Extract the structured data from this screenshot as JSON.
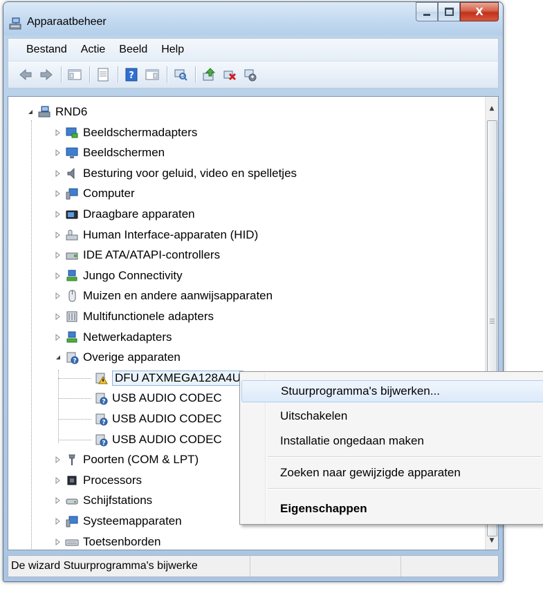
{
  "window": {
    "title": "Apparaatbeheer",
    "close_glyph": "X"
  },
  "menubar": {
    "items": [
      "Bestand",
      "Actie",
      "Beeld",
      "Help"
    ]
  },
  "toolbar": {
    "buttons": [
      "back-icon",
      "forward-icon",
      "show-hide-console-tree-icon",
      "properties-icon",
      "help-icon",
      "show-action-pane-icon",
      "scan-hardware-icon",
      "update-driver-icon",
      "uninstall-icon",
      "disable-icon"
    ]
  },
  "tree": {
    "root": "RND6",
    "items": [
      {
        "label": "Beeldschermadapters",
        "icon": "display-adapter-icon"
      },
      {
        "label": "Beeldschermen",
        "icon": "monitor-icon"
      },
      {
        "label": "Besturing voor geluid, video en spelletjes",
        "icon": "speaker-icon"
      },
      {
        "label": "Computer",
        "icon": "computer-icon"
      },
      {
        "label": "Draagbare apparaten",
        "icon": "portable-device-icon"
      },
      {
        "label": "Human Interface-apparaten (HID)",
        "icon": "hid-icon"
      },
      {
        "label": "IDE ATA/ATAPI-controllers",
        "icon": "ide-controller-icon"
      },
      {
        "label": "Jungo Connectivity",
        "icon": "network-device-icon"
      },
      {
        "label": "Muizen en andere aanwijsapparaten",
        "icon": "mouse-icon"
      },
      {
        "label": "Multifunctionele adapters",
        "icon": "multifunction-adapter-icon"
      },
      {
        "label": "Netwerkadapters",
        "icon": "network-adapter-icon"
      },
      {
        "label": "Overige apparaten",
        "icon": "unknown-device-icon"
      }
    ],
    "other_devices": [
      {
        "label": "DFU ATXMEGA128A4U",
        "icon": "warning-device-icon"
      },
      {
        "label": "USB AUDIO  CODEC",
        "icon": "unknown-device-icon"
      },
      {
        "label": "USB AUDIO  CODEC",
        "icon": "unknown-device-icon"
      },
      {
        "label": "USB AUDIO  CODEC",
        "icon": "unknown-device-icon"
      }
    ],
    "items_after": [
      {
        "label": "Poorten (COM & LPT)",
        "icon": "port-icon"
      },
      {
        "label": "Processors",
        "icon": "processor-icon"
      },
      {
        "label": "Schijfstations",
        "icon": "disk-drive-icon"
      },
      {
        "label": "Systeemapparaten",
        "icon": "system-device-icon"
      },
      {
        "label": "Toetsenborden",
        "icon": "keyboard-icon"
      }
    ]
  },
  "context_menu": {
    "items": [
      "Stuurprogramma's bijwerken...",
      "Uitschakelen",
      "Installatie ongedaan maken",
      "Zoeken naar gewijzigde apparaten",
      "Eigenschappen"
    ]
  },
  "statusbar": {
    "text": "De wizard Stuurprogramma's bijwerke",
    "cell2": "",
    "cell3": ""
  },
  "colors": {
    "title_gradient_top": "#dbe9f7",
    "close_button": "#c1321b",
    "selection_border": "#8fb4dd",
    "menu_highlight": "#dceafa"
  }
}
